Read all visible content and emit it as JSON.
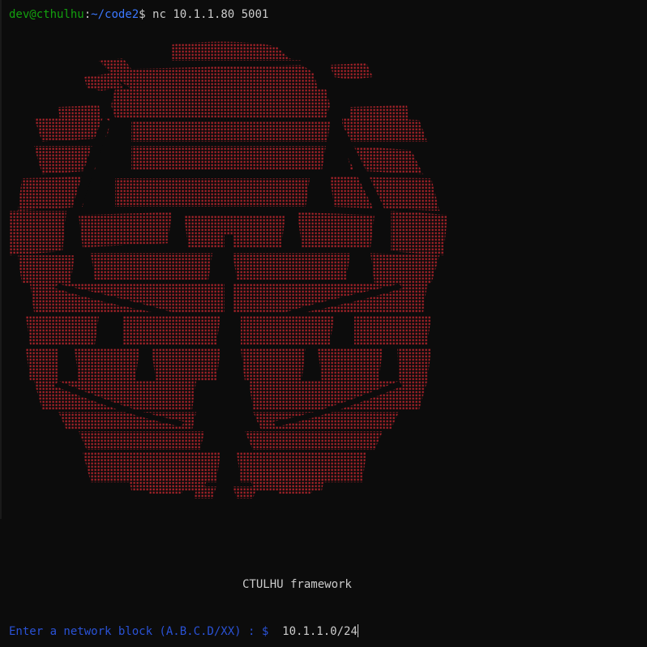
{
  "terminal": {
    "prompt_user": "dev@cthulhu",
    "prompt_colon": ":",
    "prompt_path": "~/code2",
    "prompt_symbol": "$ ",
    "command": "nc 10.1.1.80 5001"
  },
  "banner": {
    "art_color": "#b5242b",
    "art_description_icon": "cthulhu-ascii-art"
  },
  "framework_title": "CTULHU framework",
  "input": {
    "prompt": "Enter a network block (A.B.C.D/XX) : $  ",
    "value": "10.1.1.0/24"
  },
  "colors": {
    "background": "#0c0c0c",
    "user_green": "#13a10e",
    "path_blue": "#3b78ff",
    "prompt_blue": "#2a52d6",
    "text": "#cccccc"
  }
}
